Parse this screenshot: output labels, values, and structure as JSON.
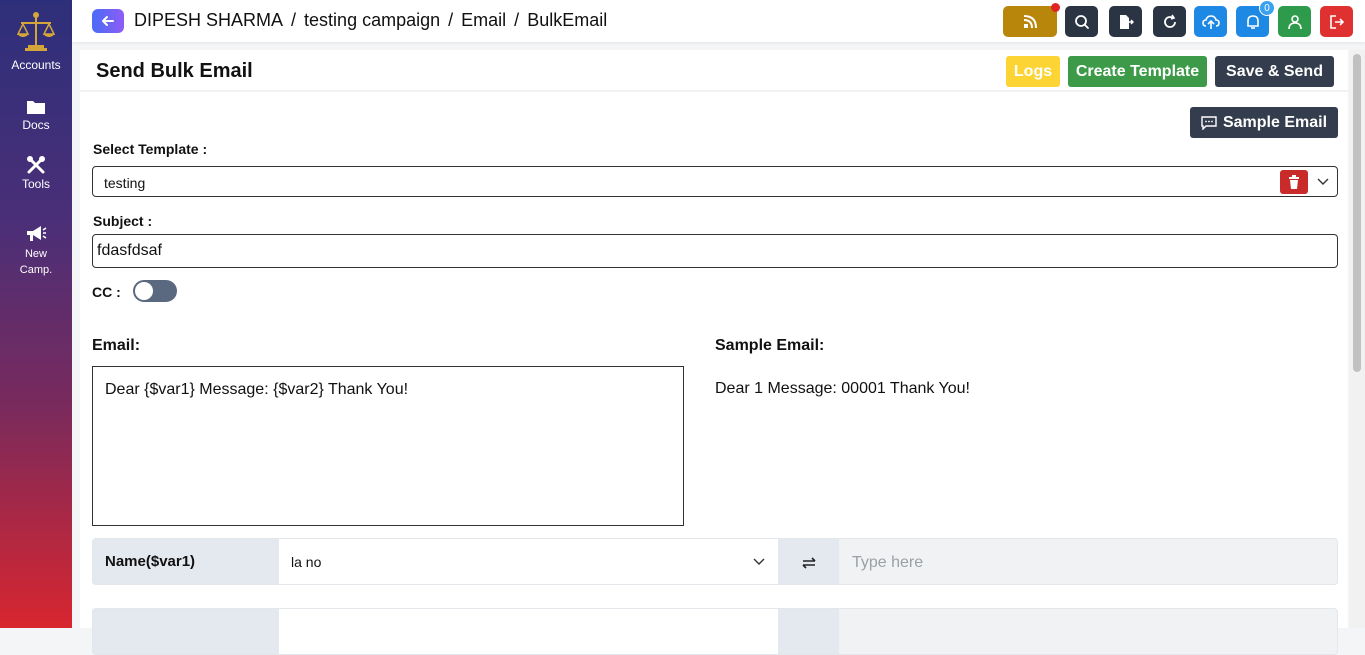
{
  "sidebar": {
    "items": [
      {
        "label": "Accounts",
        "icon": "scales-icon"
      },
      {
        "label": "Docs",
        "icon": "folder-icon"
      },
      {
        "label": "Tools",
        "icon": "tools-icon"
      },
      {
        "label_line1": "New",
        "label_line2": "Camp.",
        "icon": "megaphone-icon"
      }
    ]
  },
  "topbar": {
    "breadcrumb": [
      "DIPESH SHARMA",
      "testing campaign",
      "Email",
      "BulkEmail"
    ],
    "separator": "/",
    "notification_count": "0",
    "colors": {
      "rss": "#b8860b",
      "dark": "#2a3442",
      "blue": "#1e88e5",
      "green": "#2e9a4b",
      "red": "#e03131"
    }
  },
  "header": {
    "title": "Send Bulk Email",
    "logs_label": "Logs",
    "create_template_label": "Create Template",
    "save_send_label": "Save & Send"
  },
  "form": {
    "sample_email_button": "Sample Email",
    "select_template_label": "Select Template :",
    "template_value": "testing",
    "subject_label": "Subject :",
    "subject_value": "fdasfdsaf",
    "cc_label": "CC :",
    "cc_enabled": false
  },
  "email": {
    "email_heading": "Email:",
    "email_body": "Dear {$var1} Message: {$var2} Thank You!",
    "sample_heading": "Sample Email:",
    "sample_body": "Dear 1 Message: 00001 Thank You!"
  },
  "variables": [
    {
      "name": "Name($var1)",
      "selected": "la no",
      "placeholder": "Type here"
    }
  ]
}
